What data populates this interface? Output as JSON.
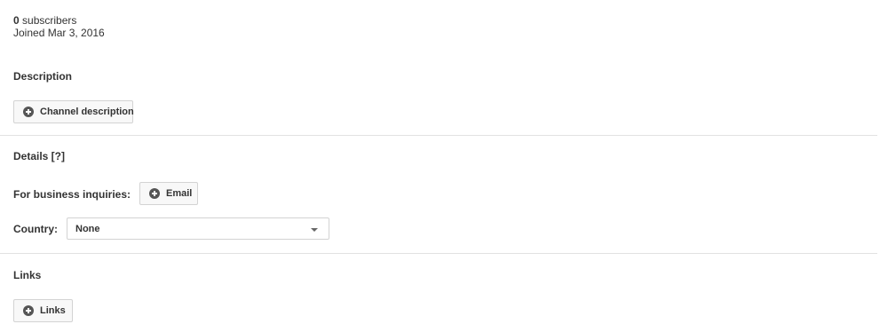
{
  "about": {
    "subscriber_count": "0",
    "subscriber_label": "subscribers",
    "joined": "Joined Mar 3, 2016"
  },
  "description": {
    "title": "Description",
    "button_label": "Channel description",
    "button_icon": "add-circle-icon"
  },
  "details": {
    "title": "Details [?]",
    "business_label": "For business inquiries:",
    "email_button_label": "Email",
    "country_label": "Country:",
    "country_value": "None"
  },
  "links": {
    "title": "Links",
    "button_label": "Links"
  },
  "colors": {
    "text": "#333333",
    "button_bg": "#f8f8f8",
    "button_border": "#d3d3d3",
    "divider": "#e2e2e2",
    "icon": "#555555"
  }
}
